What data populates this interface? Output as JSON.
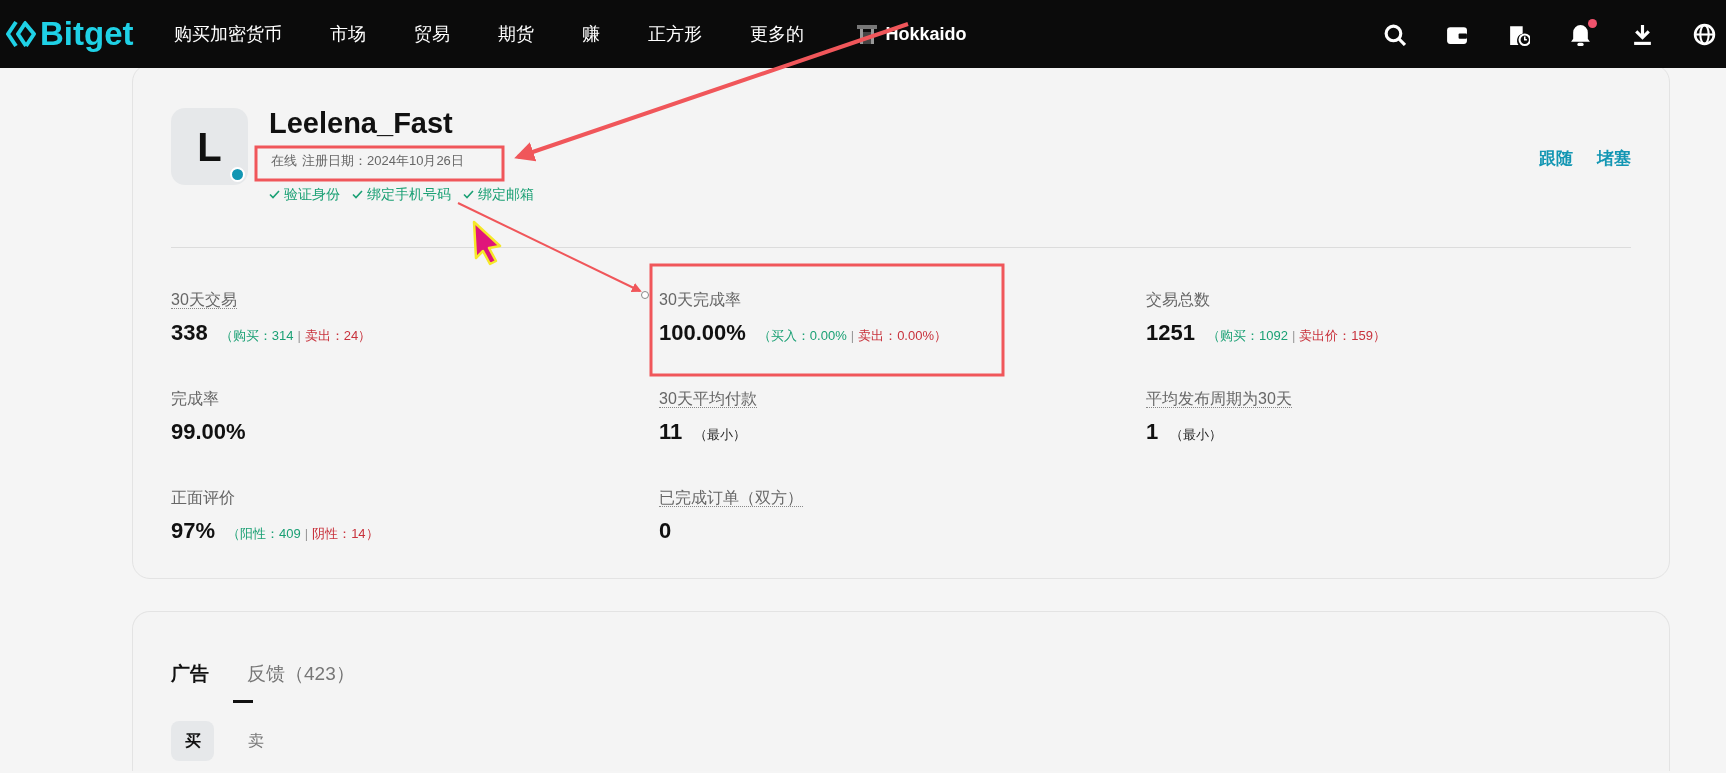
{
  "nav": {
    "logo": "Bitget",
    "items": [
      "购买加密货币",
      "市场",
      "贸易",
      "期货",
      "赚",
      "正方形",
      "更多的"
    ],
    "user": "Hokkaido",
    "has_unread": true
  },
  "profile": {
    "initial": "L",
    "online": true,
    "name": "Leelena_Fast",
    "status": "在线",
    "registered": "注册日期：2024年10月26日",
    "verifications": [
      {
        "label": "验证身份",
        "verified": true
      },
      {
        "label": "绑定手机号码",
        "verified": true
      },
      {
        "label": "绑定邮箱",
        "verified": true
      }
    ],
    "actions": [
      "跟随",
      "堵塞"
    ]
  },
  "stats": [
    {
      "label": "30天交易",
      "hint": true,
      "value": "338",
      "breakdown": [
        {
          "text": "（购买：314",
          "kind": "buy"
        },
        {
          "text": "|",
          "kind": "separator"
        },
        {
          "text": "卖出：24）",
          "kind": "sell"
        }
      ]
    },
    {
      "label": "30天完成率",
      "hint": false,
      "value": "100.00%",
      "breakdown": [
        {
          "text": "（买入：0.00%",
          "kind": "buy"
        },
        {
          "text": "|",
          "kind": "separator"
        },
        {
          "text": "卖出：0.00%）",
          "kind": "sell"
        }
      ]
    },
    {
      "label": "交易总数",
      "hint": false,
      "value": "1251",
      "breakdown": [
        {
          "text": "（购买：1092",
          "kind": "buy"
        },
        {
          "text": "|",
          "kind": "separator"
        },
        {
          "text": "卖出价：159）",
          "kind": "sell"
        }
      ]
    },
    {
      "label": "完成率",
      "hint": false,
      "value": "99.00%"
    },
    {
      "label": "30天平均付款",
      "hint": true,
      "value": "11",
      "breakdown": [
        {
          "text": "（最小）",
          "kind": "note"
        }
      ]
    },
    {
      "label": "平均发布周期为30天",
      "hint": true,
      "value": "1",
      "breakdown": [
        {
          "text": "（最小）",
          "kind": "note"
        }
      ]
    },
    {
      "label": "正面评价",
      "hint": false,
      "value": "97%",
      "breakdown": [
        {
          "text": "（阳性：409",
          "kind": "buy"
        },
        {
          "text": "|",
          "kind": "separator"
        },
        {
          "text": "阴性：14）",
          "kind": "sell"
        }
      ]
    },
    {
      "label": "已完成订单（双方）",
      "hint": true,
      "value": "0"
    }
  ],
  "tabs": [
    {
      "label": "广告",
      "selected": true
    },
    {
      "label": "反馈（423）",
      "selected": false
    }
  ],
  "sides": [
    {
      "label": "买",
      "selected": true
    },
    {
      "label": "卖",
      "selected": false
    }
  ]
}
